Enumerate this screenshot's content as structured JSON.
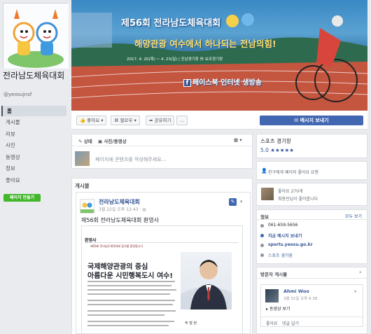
{
  "sidebar": {
    "page_name": "전라남도체육대회",
    "handle": "@yeosujnsf",
    "items": [
      {
        "label": "홈"
      },
      {
        "label": "게시물"
      },
      {
        "label": "리뷰"
      },
      {
        "label": "사진"
      },
      {
        "label": "동영상"
      },
      {
        "label": "정보"
      },
      {
        "label": "좋아요"
      }
    ],
    "create_page": "페이지 만들기"
  },
  "cover": {
    "title": "제56회 전라남도체육대회",
    "slogan": "해양관광 여수에서 하나되는 전남의힘!",
    "date": "2017. 4. 20(목) ~ 4. 23(일) | 진남경기장 外 보조경기장",
    "facebook_text": "페이스북 인터넷 생방송",
    "fb_glyph": "f"
  },
  "actions": {
    "like": "좋아요",
    "follow": "팔로우",
    "share": "공유하기",
    "more": "...",
    "message": "메시지 보내기"
  },
  "composer": {
    "status_tab": "상태",
    "photo_tab": "사진/동영상",
    "placeholder": "페이지에 콘텐츠를 작성해주세요..."
  },
  "posts": {
    "section_label": "게시물",
    "post": {
      "author": "전라남도체육대회",
      "time": "3월 22일 오후 12:43",
      "text": "제56회 전라남도체육대회 환영사",
      "doc_title": "환영사",
      "doc_sub": "제56회 전라남도체육대회 참가를 환영합니다",
      "doc_h1": "국제해양관광의 중심",
      "doc_h2": "아름다운 시민행복도시 여수!",
      "doc_sig": "주 철 현"
    }
  },
  "right": {
    "category": "스포츠 경기장",
    "rating": "5.0 ★★★★★",
    "invite": "친구에게 페이지 좋아요 요청",
    "likes_count": "좋아요 270개",
    "likes_friend": "최용진님이 좋아합니다",
    "info_header": "정보",
    "info_edit": "모두 보기",
    "phone": "061-659-5656",
    "send_message": "지금 메시지 보내기",
    "website": "sports.yeosu.go.kr",
    "type": "스포츠 경기장",
    "visitor_header": "방문자 게시물",
    "visitor": {
      "name": "Ahmi Woo",
      "time": "3월 31일 오후 6:38",
      "text": "동영상 보기",
      "like": "좋아요",
      "comment": "댓글 달기"
    }
  },
  "colors": {
    "brand": "#4267b2",
    "link": "#365899",
    "green": "#42b72a",
    "background": "#e9ebee"
  }
}
